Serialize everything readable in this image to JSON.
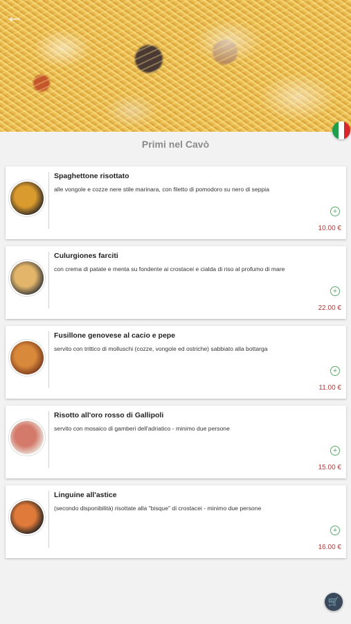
{
  "header": {
    "back_icon": "arrow-left-icon",
    "flag_icon": "italy-flag-icon"
  },
  "section": {
    "title": "Primi nel Cavò"
  },
  "items": [
    {
      "name": "Spaghettone risottato",
      "description": "alle vongole e cozze nere stile marinara, con filetto di pomodoro su nero di seppia",
      "price": "10.00 €",
      "thumb_colors": [
        "#2f2a26",
        "#d99a2e"
      ]
    },
    {
      "name": "Culurgiones farciti",
      "description": "con crema di patate e menta su fondente ai crostacei e cialda di riso al profumo di mare",
      "price": "22.00 €",
      "thumb_colors": [
        "#3a3a3a",
        "#e2b56a"
      ]
    },
    {
      "name": "Fusillone genovese al cacio e pepe",
      "description": "servito con trittico di molluschi (cozze, vongole ed ostriche) sabbiato alla bottarga",
      "price": "11.00 €",
      "thumb_colors": [
        "#7a3a1e",
        "#d9893a"
      ]
    },
    {
      "name": "Risotto all'oro rosso di Gallipoli",
      "description": "servito con mosaico di gamberi dell'adriatico - minimo due persone",
      "price": "15.00 €",
      "thumb_colors": [
        "#e9e2da",
        "#d47a6a"
      ]
    },
    {
      "name": "Linguine all'astice",
      "description": "(secondo disponibilità) risottate alla \"bisque\" di crostacei - minimo due persone",
      "price": "16.00 €",
      "thumb_colors": [
        "#222222",
        "#e07a3a"
      ]
    }
  ],
  "icons": {
    "add": "plus-circle-icon",
    "cart": "cart-icon"
  },
  "colors": {
    "price": "#b23a3a",
    "add": "#5aa86a",
    "fab": "#3a4a5c"
  }
}
